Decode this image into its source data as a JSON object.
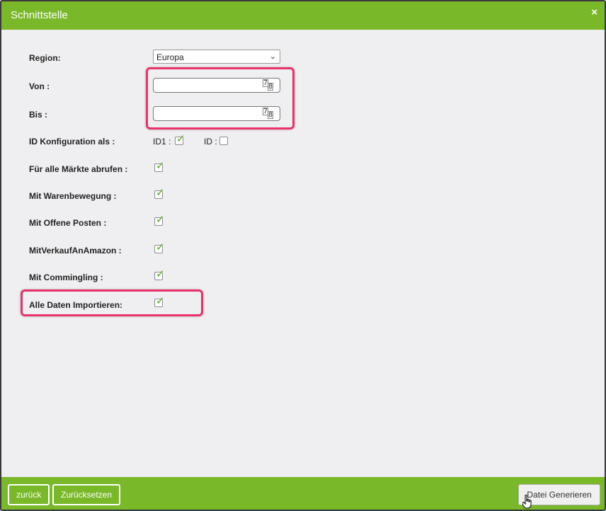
{
  "dialog": {
    "title": "Schnittstelle",
    "close_icon": "×"
  },
  "form": {
    "region_label": "Region:",
    "region_value": "Europa",
    "von_label": "Von :",
    "von_value": "",
    "bis_label": "Bis :",
    "bis_value": "",
    "id_config_label": "ID Konfiguration als :",
    "id1_label": "ID1 :",
    "id1_checked": true,
    "id_label": "ID :",
    "id_checked": false,
    "all_markets_label": "Für alle Märkte abrufen :",
    "all_markets_checked": true,
    "warenbewegung_label": "Mit Warenbewegung :",
    "warenbewegung_checked": true,
    "offene_posten_label": "Mit Offene Posten :",
    "offene_posten_checked": true,
    "verkauf_amazon_label": "MitVerkaufAnAmazon :",
    "verkauf_amazon_checked": true,
    "commingling_label": "Mit Commingling :",
    "commingling_checked": true,
    "alle_daten_label": "Alle Daten Importieren:",
    "alle_daten_checked": true
  },
  "footer": {
    "back_label": "zurück",
    "reset_label": "Zurücksetzen",
    "generate_label": "Datei Generieren"
  },
  "colors": {
    "header_green": "#79b828",
    "highlight_pink": "#e8336a",
    "checkmark_green": "#5aa61e"
  },
  "icons": {
    "calendar_digit_1": "7",
    "calendar_digit_2": "8"
  }
}
